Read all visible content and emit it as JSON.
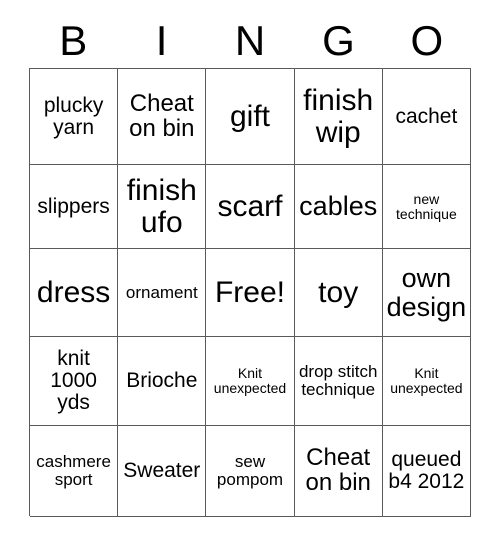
{
  "card": {
    "header_letters": [
      "B",
      "I",
      "N",
      "G",
      "O"
    ],
    "rows": [
      [
        {
          "text": "plucky yarn",
          "size": "md"
        },
        {
          "text": "Cheat on bin",
          "size": "lg"
        },
        {
          "text": "gift",
          "size": "xxl"
        },
        {
          "text": "finish wip",
          "size": "xxl"
        },
        {
          "text": "cachet",
          "size": "md"
        }
      ],
      [
        {
          "text": "slippers",
          "size": "md"
        },
        {
          "text": "finish ufo",
          "size": "xxl"
        },
        {
          "text": "scarf",
          "size": "xxl"
        },
        {
          "text": "cables",
          "size": "xl"
        },
        {
          "text": "new technique",
          "size": "xs"
        }
      ],
      [
        {
          "text": "dress",
          "size": "xxl"
        },
        {
          "text": "ornament",
          "size": "sm"
        },
        {
          "text": "Free!",
          "size": "xxl"
        },
        {
          "text": "toy",
          "size": "xxl"
        },
        {
          "text": "own design",
          "size": "xl"
        }
      ],
      [
        {
          "text": "knit 1000 yds",
          "size": "md"
        },
        {
          "text": "Brioche",
          "size": "md"
        },
        {
          "text": "Knit unexpected",
          "size": "xs"
        },
        {
          "text": "drop stitch technique",
          "size": "sm"
        },
        {
          "text": "Knit unexpected",
          "size": "xs"
        }
      ],
      [
        {
          "text": "cashmere sport",
          "size": "sm"
        },
        {
          "text": "Sweater",
          "size": "md"
        },
        {
          "text": "sew pompom",
          "size": "sm"
        },
        {
          "text": "Cheat on bin",
          "size": "lg"
        },
        {
          "text": "queued b4 2012",
          "size": "md"
        }
      ]
    ]
  }
}
